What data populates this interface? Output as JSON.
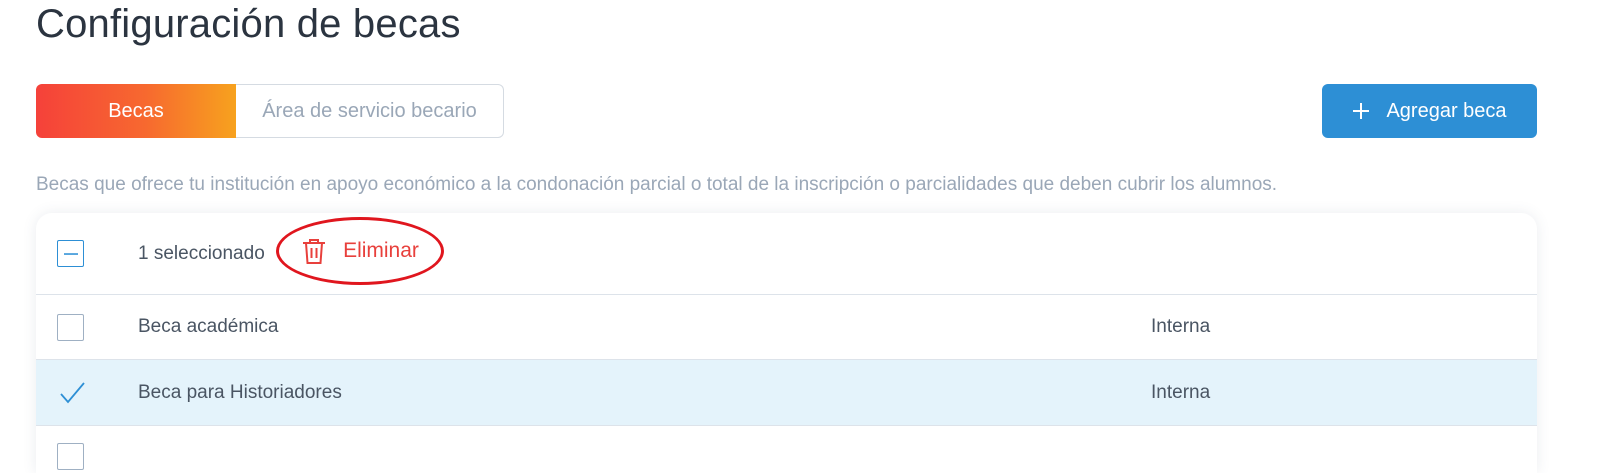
{
  "page": {
    "title": "Configuración de becas"
  },
  "tabs": [
    {
      "label": "Becas",
      "active": true
    },
    {
      "label": "Área de servicio becario",
      "active": false
    }
  ],
  "actions": {
    "add_label": "Agregar beca",
    "add_icon": "plus-icon"
  },
  "description": "Becas que ofrece tu institución en apoyo económico a la condonación parcial o total de la inscripción o parcialidades que deben cubrir los alumnos.",
  "table": {
    "selection": {
      "count_label": "1 seleccionado",
      "delete_label": "Eliminar",
      "delete_icon": "trash-icon"
    },
    "rows": [
      {
        "name": "Beca académica",
        "type": "Interna",
        "selected": false
      },
      {
        "name": "Beca para Historiadores",
        "type": "Interna",
        "selected": true
      }
    ]
  },
  "colors": {
    "primary": "#2d8fd5",
    "tab_gradient_start": "#f5413a",
    "tab_gradient_end": "#f7a21e",
    "danger": "#e8403c",
    "selected_row": "#e4f3fb"
  }
}
